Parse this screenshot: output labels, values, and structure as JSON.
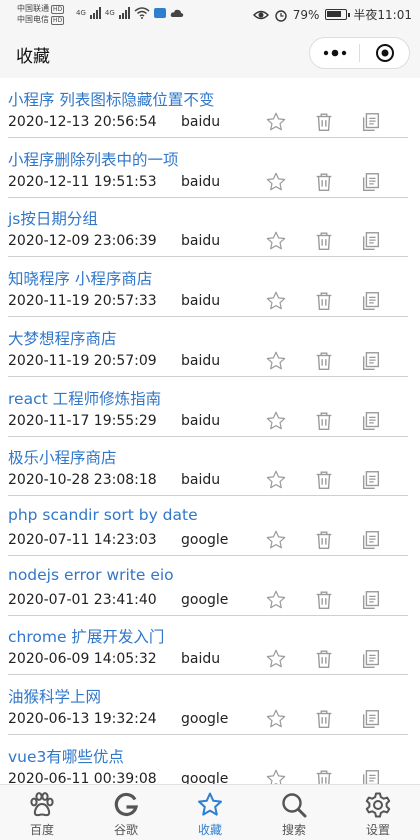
{
  "status_bar": {
    "carrier1": "中国联通",
    "carrier2": "中国电信",
    "hd": "HD",
    "net1": "4G",
    "net2": "4G",
    "battery_pct": "79%",
    "battery_level": 0.79,
    "time": "半夜11:01"
  },
  "nav": {
    "title": "收藏",
    "menu_icon": "more-dots-icon",
    "close_icon": "target-circle-icon"
  },
  "items": [
    {
      "title": "小程序 列表图标隐藏位置不变",
      "date": "2020-12-13 20:56:54",
      "source": "baidu"
    },
    {
      "title": "小程序删除列表中的一项",
      "date": "2020-12-11 19:51:53",
      "source": "baidu"
    },
    {
      "title": "js按日期分组",
      "date": "2020-12-09 23:06:39",
      "source": "baidu"
    },
    {
      "title": "知晓程序 小程序商店",
      "date": "2020-11-19 20:57:33",
      "source": "baidu"
    },
    {
      "title": "大梦想程序商店",
      "date": "2020-11-19 20:57:09",
      "source": "baidu"
    },
    {
      "title": "react 工程师修炼指南",
      "date": "2020-11-17 19:55:29",
      "source": "baidu"
    },
    {
      "title": "极乐小程序商店",
      "date": "2020-10-28 23:08:18",
      "source": "baidu"
    },
    {
      "title": "php scandir sort by date",
      "date": "2020-07-11 14:23:03",
      "source": "google"
    },
    {
      "title": "nodejs error write eio",
      "date": "2020-07-01 23:41:40",
      "source": "google"
    },
    {
      "title": "chrome 扩展开发入门",
      "date": "2020-06-09 14:05:32",
      "source": "baidu"
    },
    {
      "title": "油猴科学上网",
      "date": "2020-06-13 19:32:24",
      "source": "google"
    },
    {
      "title": "vue3有哪些优点",
      "date": "2020-06-11 00:39:08",
      "source": "google"
    }
  ],
  "tabs": [
    {
      "label": "百度",
      "icon": "paw-icon",
      "active": false
    },
    {
      "label": "谷歌",
      "icon": "google-g-icon",
      "active": false
    },
    {
      "label": "收藏",
      "icon": "star-icon",
      "active": true
    },
    {
      "label": "搜索",
      "icon": "search-icon",
      "active": false
    },
    {
      "label": "设置",
      "icon": "gear-icon",
      "active": false
    }
  ],
  "colors": {
    "accent": "#2f7fd1",
    "title_link": "#3177c9",
    "icon_gray": "#9a9a9a"
  }
}
